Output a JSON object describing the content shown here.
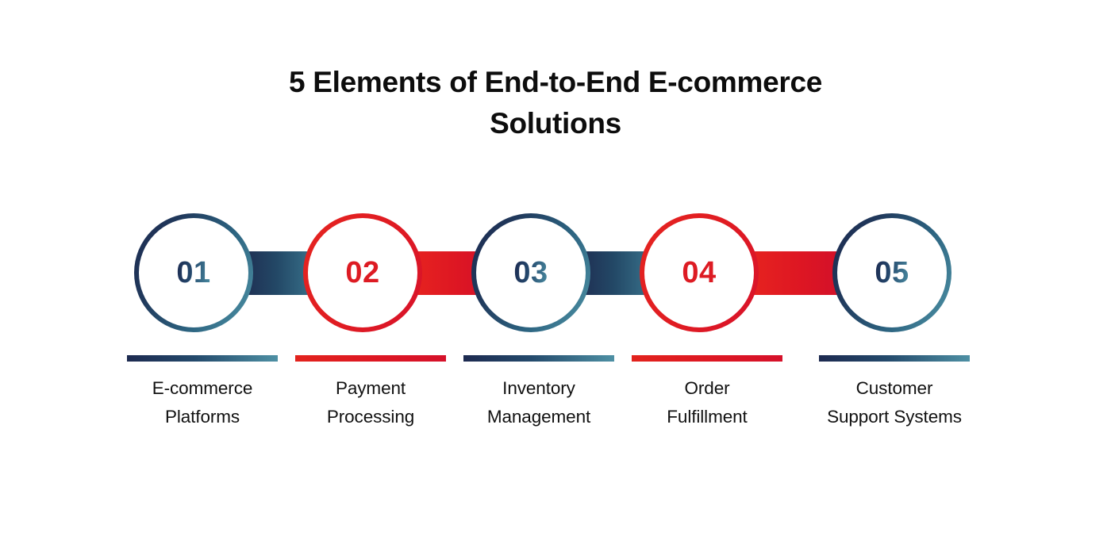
{
  "title": {
    "line1": "5 Elements of End-to-End E-commerce",
    "line2": "Solutions"
  },
  "colors": {
    "navy": "#1d2a50",
    "teal": "#4e90a4",
    "red": "#dd1b23",
    "text": "#111111",
    "background": "#ffffff"
  },
  "steps": [
    {
      "number": "01",
      "label_line1": "E-commerce",
      "label_line2": "Platforms",
      "style": "blue"
    },
    {
      "number": "02",
      "label_line1": "Payment",
      "label_line2": "Processing",
      "style": "red"
    },
    {
      "number": "03",
      "label_line1": "Inventory",
      "label_line2": "Management",
      "style": "blue"
    },
    {
      "number": "04",
      "label_line1": "Order",
      "label_line2": "Fulfillment",
      "style": "red"
    },
    {
      "number": "05",
      "label_line1": "Customer",
      "label_line2": "Support Systems",
      "style": "blue"
    }
  ]
}
